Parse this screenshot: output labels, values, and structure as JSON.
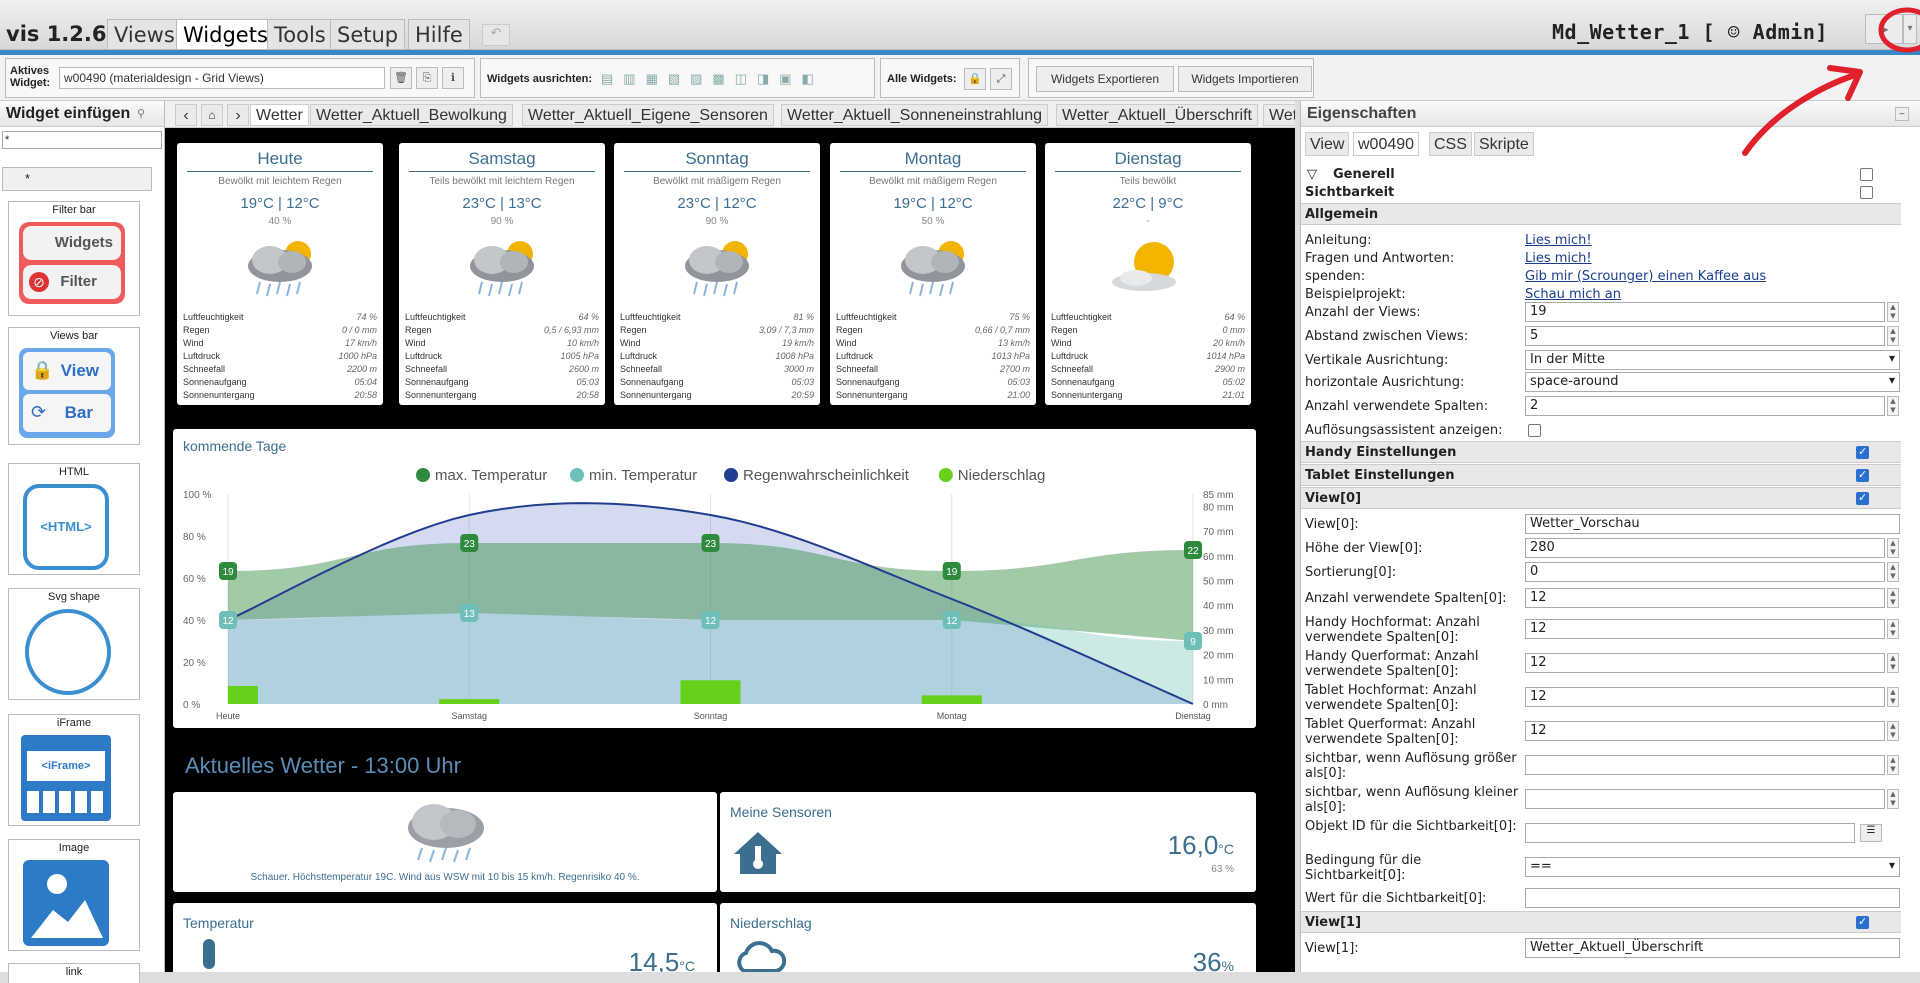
{
  "app": {
    "version": "vis 1.2.6",
    "project": "Md_Wetter_1 [ ☺ Admin]"
  },
  "menu": [
    "Views",
    "Widgets",
    "Tools",
    "Setup",
    "Hilfe"
  ],
  "toolbar": {
    "active_widget_label": "Aktives Widget:",
    "active_widget_value": "w00490 (materialdesign - Grid Views)",
    "align_label": "Widgets ausrichten:",
    "all_label": "Alle Widgets:",
    "export": "Widgets Exportieren",
    "import": "Widgets Importieren"
  },
  "left": {
    "title": "Widget einfügen",
    "filter_value": "*",
    "set_value": "*",
    "cards": [
      {
        "label": "Filter bar",
        "a": "Widgets",
        "b": "Filter"
      },
      {
        "label": "Views bar",
        "a": "View",
        "b": "Bar"
      },
      {
        "label": "HTML",
        "a": "<HTML>"
      },
      {
        "label": "Svg shape"
      },
      {
        "label": "iFrame",
        "a": "<iFrame>"
      },
      {
        "label": "Image"
      },
      {
        "label": "link"
      }
    ]
  },
  "view_tabs": [
    "Wetter",
    "Wetter_Aktuell_Bewolkung",
    "Wetter_Aktuell_Eigene_Sensoren",
    "Wetter_Aktuell_Sonneneinstrahlung",
    "Wetter_Aktuell_Überschrift",
    "Wet"
  ],
  "forecast": {
    "row_labels": [
      "Luftfeuchtigkeit",
      "Regen",
      "Wind",
      "Luftdruck",
      "Schneefall",
      "Sonnenaufgang",
      "Sonnenuntergang"
    ],
    "days": [
      {
        "name": "Heute",
        "desc": "Bewölkt mit leichtem Regen",
        "temps": "19°C  |  12°C",
        "pct": "40 %",
        "icon": "rain-cloud-icon",
        "vals": [
          "74 %",
          "0 / 0 mm",
          "17 km/h",
          "1000 hPa",
          "2200 m",
          "05:04",
          "20:58"
        ]
      },
      {
        "name": "Samstag",
        "desc": "Teils bewölkt mit leichtem Regen",
        "temps": "23°C  |  13°C",
        "pct": "90 %",
        "icon": "rain-cloud-icon",
        "vals": [
          "64 %",
          "0,5 / 6,93 mm",
          "10 km/h",
          "1005 hPa",
          "2600 m",
          "05:03",
          "20:58"
        ]
      },
      {
        "name": "Sonntag",
        "desc": "Bewölkt mit mäßigem Regen",
        "temps": "23°C  |  12°C",
        "pct": "90 %",
        "icon": "rain-cloud-icon",
        "vals": [
          "81 %",
          "3,09 / 7,3 mm",
          "19 km/h",
          "1008 hPa",
          "3000 m",
          "05:03",
          "20:59"
        ]
      },
      {
        "name": "Montag",
        "desc": "Bewölkt mit mäßigem Regen",
        "temps": "19°C  |  12°C",
        "pct": "50 %",
        "icon": "rain-cloud-icon",
        "vals": [
          "75 %",
          "0,66 / 0,7 mm",
          "13 km/h",
          "1013 hPa",
          "2700 m",
          "05:03",
          "21:00"
        ]
      },
      {
        "name": "Dienstag",
        "desc": "Teils bewölkt",
        "temps": "22°C  |  9°C",
        "pct": "-",
        "icon": "sun-cloud-icon",
        "vals": [
          "64 %",
          "0 mm",
          "20 km/h",
          "1014 hPa",
          "2900 m",
          "05:02",
          "21:01"
        ]
      }
    ]
  },
  "chart_data": {
    "type": "line",
    "title": "kommende Tage",
    "categories": [
      "Heute",
      "Samstag",
      "Sonntag",
      "Montag",
      "Dienstag"
    ],
    "series": [
      {
        "name": "max. Temperatur",
        "values": [
          19,
          23,
          23,
          19,
          22
        ],
        "color": "#2e8b3d"
      },
      {
        "name": "min. Temperatur",
        "values": [
          12,
          13,
          12,
          12,
          9
        ],
        "color": "#6dbfb8"
      },
      {
        "name": "Regenwahrscheinlichkeit",
        "values": [
          40,
          90,
          90,
          50,
          0
        ],
        "color": "#1f3e8f"
      },
      {
        "name": "Niederschlag",
        "values": [
          7.3,
          2,
          9.6,
          3.5,
          0
        ],
        "color": "#66d11a"
      }
    ],
    "yleft_ticks": [
      "100 %",
      "80 %",
      "60 %",
      "40 %",
      "20 %",
      "0 %"
    ],
    "yright_ticks": [
      "85 mm",
      "80 mm",
      "70 mm",
      "60 mm",
      "50 mm",
      "40 mm",
      "30 mm",
      "20 mm",
      "10 mm",
      "0 mm"
    ],
    "ylim_pct": [
      0,
      100
    ],
    "ylim_mm": [
      0,
      85
    ]
  },
  "current": {
    "title": "Aktuelles Wetter - 13:00 Uhr",
    "summary": "Schauer. Höchsttemperatur 19C. Wind aus WSW mit 10 bis 15 km/h. Regenrisiko 40 %.",
    "sensors_title": "Meine Sensoren",
    "sensor_value": "16,0",
    "sensor_unit": "°C",
    "sensor_sub": "63 %",
    "temp_title": "Temperatur",
    "temp_value": "14,5",
    "temp_unit": "°C",
    "rain_title": "Niederschlag",
    "rain_value": "36",
    "rain_unit": "%"
  },
  "props": {
    "title": "Eigenschaften",
    "tabs": [
      "View",
      "w00490",
      "CSS",
      "Skripte"
    ],
    "generell": "Generell",
    "sichtbarkeit": "Sichtbarkeit",
    "allgemein": "Allgemein",
    "links": [
      {
        "label": "Anleitung:",
        "value": "Lies mich!"
      },
      {
        "label": "Fragen und Antworten:",
        "value": "Lies mich!"
      },
      {
        "label": "spenden:",
        "value": "Gib mir (Scrounger) einen Kaffee aus"
      },
      {
        "label": "Beispielprojekt:",
        "value": "Schau mich an"
      }
    ],
    "anzahl_views_label": "Anzahl der Views:",
    "anzahl_views": "19",
    "abstand_label": "Abstand zwischen Views:",
    "abstand": "5",
    "vert_label": "Vertikale Ausrichtung:",
    "vert": "In der Mitte",
    "horiz_label": "horizontale Ausrichtung:",
    "horiz": "space-around",
    "spalten_label": "Anzahl verwendete Spalten:",
    "spalten": "2",
    "assist_label": "Auflösungsassistent anzeigen:",
    "handy": "Handy Einstellungen",
    "tablet": "Tablet Einstellungen",
    "view0": "View[0]",
    "view0_label": "View[0]:",
    "view0_val": "Wetter_Vorschau",
    "hoehe_label": "Höhe der View[0]:",
    "hoehe": "280",
    "sort_label": "Sortierung[0]:",
    "sort": "0",
    "sp0_label": "Anzahl verwendete Spalten[0]:",
    "sp0": "12",
    "hh_label": "Handy Hochformat: Anzahl verwendete Spalten[0]:",
    "hh": "12",
    "hq_label": "Handy Querformat: Anzahl verwendete Spalten[0]:",
    "hq": "12",
    "th_label": "Tablet Hochformat: Anzahl verwendete Spalten[0]:",
    "th": "12",
    "tq_label": "Tablet Querformat: Anzahl verwendete Spalten[0]:",
    "tq": "12",
    "sg_label": "sichtbar, wenn Auflösung größer als[0]:",
    "sk_label": "sichtbar, wenn Auflösung kleiner als[0]:",
    "oid_label": "Objekt ID für die Sichtbarkeit[0]:",
    "bed_label": "Bedingung für die Sichtbarkeit[0]:",
    "bed": "==",
    "wert_label": "Wert für die Sichtbarkeit[0]:",
    "view1": "View[1]",
    "view1_label": "View[1]:",
    "view1_val": "Wetter_Aktuell_Überschrift"
  },
  "colors": {
    "accent": "#3a87c8",
    "annotation": "#e0202a"
  }
}
